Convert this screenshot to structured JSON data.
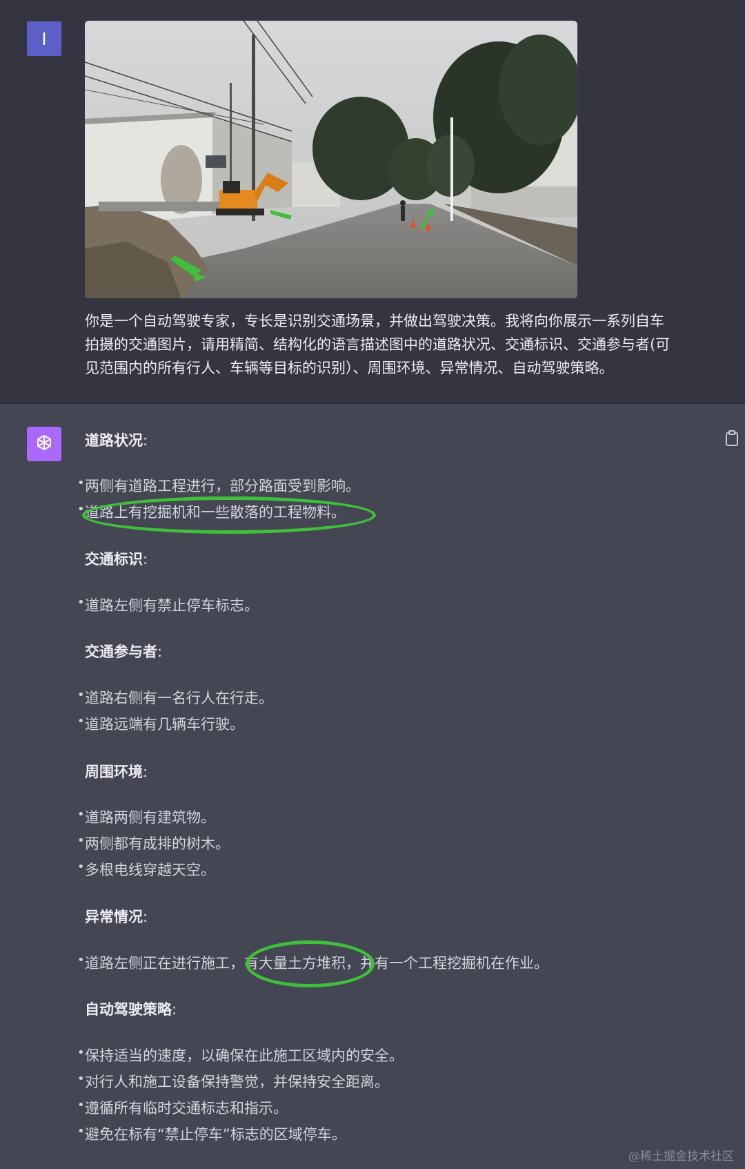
{
  "user": {
    "avatar_letter": "I",
    "prompt_lines": [
      "你是一个自动驾驶专家，专长是识别交通场景，并做出驾驶决策。我将向你展示一系列自车",
      "拍摄的交通图片，请用精简、结构化的语言描述图中的道路状况、交通标识、交通参与者(可",
      "见范围内的所有行人、车辆等目标的识别）、周围环境、异常情况、自动驾驶策略。"
    ]
  },
  "assistant": {
    "sections": [
      {
        "heading": "道路状况",
        "items": [
          "两侧有道路工程进行，部分路面受到影响。",
          "道路上有挖掘机和一些散落的工程物料。"
        ]
      },
      {
        "heading": "交通标识",
        "items": [
          "道路左侧有禁止停车标志。"
        ]
      },
      {
        "heading": "交通参与者",
        "items": [
          "道路右侧有一名行人在行走。",
          "道路远端有几辆车行驶。"
        ]
      },
      {
        "heading": "周围环境",
        "items": [
          "道路两侧有建筑物。",
          "两侧都有成排的树木。",
          "多根电线穿越天空。"
        ]
      },
      {
        "heading": "异常情况",
        "items": [
          "道路左侧正在进行施工，有大量土方堆积，并有一个工程挖掘机在作业。"
        ]
      },
      {
        "heading": "自动驾驶策略",
        "items": [
          "保持适当的速度，以确保在此施工区域内的安全。",
          "对行人和施工设备保持警觉，并保持安全距离。",
          "遵循所有临时交通标志和指示。",
          "避免在标有“禁止停车”标志的区域停车。"
        ]
      }
    ],
    "colon": ":",
    "bullet_char": "•"
  },
  "icons": {
    "user_avatar": "user-avatar-icon",
    "assistant_avatar": "openai-logo-icon",
    "copy": "clipboard-icon"
  },
  "colors": {
    "user_bg": "#343541",
    "assistant_bg": "#444654",
    "user_avatar": "#5b5fc7",
    "assistant_avatar": "#ab68ff",
    "annotation_green": "#3fbf3a"
  },
  "watermark": "@稀土掘金技术社区"
}
